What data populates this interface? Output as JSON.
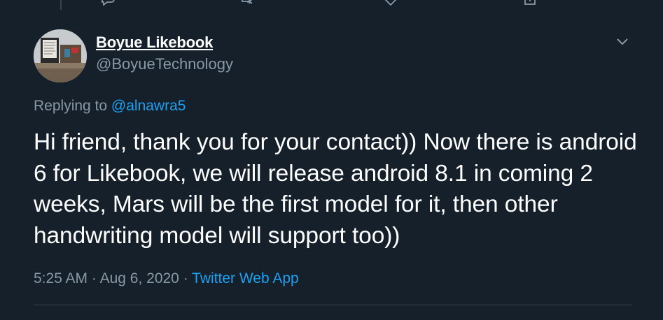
{
  "top_actions": {
    "reply_count": "",
    "retweet_count": "",
    "like_count": "",
    "share_count": ""
  },
  "tweet": {
    "author_name": "Boyue Likebook",
    "author_handle": "@BoyueTechnology",
    "replying_to_label": "Replying to",
    "replying_to_handle": "@alnawra5",
    "text": "Hi friend, thank you for your contact)) Now there is android 6 for Likebook, we will release android 8.1 in coming 2 weeks, Mars will be the first model for it, then other handwriting model will support too))",
    "time": "5:25 AM",
    "separator": "·",
    "date": "Aug 6, 2020",
    "source": "Twitter Web App"
  },
  "colors": {
    "background": "#15202b",
    "primary_text": "#ffffff",
    "secondary_text": "#8899a6",
    "accent": "#1da1f2",
    "divider": "#38444d"
  },
  "icons": {
    "reply": "reply-icon",
    "retweet": "retweet-icon",
    "like": "heart-icon",
    "share": "share-icon",
    "more": "chevron-down-icon",
    "avatar": "avatar"
  }
}
